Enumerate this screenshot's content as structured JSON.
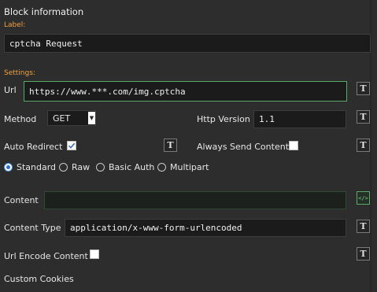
{
  "title": "Block information",
  "label_section": "Label:",
  "label_value": "cptcha Request",
  "settings_section": "Settings:",
  "url": {
    "label": "Url",
    "value": "https://www.***.com/img.cptcha"
  },
  "method": {
    "label": "Method",
    "value": "GET"
  },
  "http_version": {
    "label": "Http Version",
    "value": "1.1"
  },
  "auto_redirect": {
    "label": "Auto Redirect",
    "checked": true
  },
  "always_send_content": {
    "label": "Always Send Content",
    "checked": false
  },
  "request_types": [
    {
      "label": "Standard",
      "selected": true
    },
    {
      "label": "Raw",
      "selected": false
    },
    {
      "label": "Basic Auth",
      "selected": false
    },
    {
      "label": "Multipart",
      "selected": false
    }
  ],
  "content": {
    "label": "Content",
    "value": ""
  },
  "content_type": {
    "label": "Content Type",
    "value": "application/x-www-form-urlencoded"
  },
  "url_encode_content": {
    "label": "Url Encode Content",
    "checked": false
  },
  "custom_cookies": {
    "label": "Custom Cookies"
  },
  "buttons": {
    "variable_glyph": "T",
    "code_glyph": "</>"
  },
  "colors": {
    "accent_orange": "#f2a23a",
    "focus_green": "#5aa86a",
    "radio_blue": "#2f6fcf",
    "background": "#2d2d2d"
  }
}
